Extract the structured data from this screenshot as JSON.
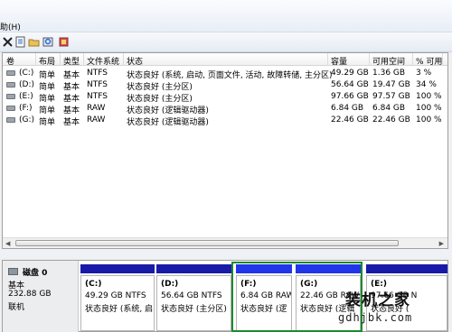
{
  "menubar": {
    "help_menu": "助(H)"
  },
  "toolbar": {
    "icons": [
      "close-icon",
      "properties-icon",
      "open-icon",
      "zoom-icon",
      "settings-icon"
    ]
  },
  "volumes": {
    "headers": [
      "卷",
      "布局",
      "类型",
      "文件系统",
      "状态",
      "容量",
      "可用空间",
      "% 可用"
    ],
    "rows": [
      {
        "vol": "(C:)",
        "layout": "简单",
        "type": "基本",
        "fs": "NTFS",
        "status": "状态良好 (系统, 启动, 页面文件, 活动, 故障转储, 主分区)",
        "capacity": "49.29 GB",
        "free": "1.36 GB",
        "pct": "3 %"
      },
      {
        "vol": "(D:)",
        "layout": "简单",
        "type": "基本",
        "fs": "NTFS",
        "status": "状态良好 (主分区)",
        "capacity": "56.64 GB",
        "free": "19.47 GB",
        "pct": "34 %"
      },
      {
        "vol": "(E:)",
        "layout": "简单",
        "type": "基本",
        "fs": "NTFS",
        "status": "状态良好 (主分区)",
        "capacity": "97.66 GB",
        "free": "97.57 GB",
        "pct": "100 %"
      },
      {
        "vol": "(F:)",
        "layout": "简单",
        "type": "基本",
        "fs": "RAW",
        "status": "状态良好 (逻辑驱动器)",
        "capacity": "6.84 GB",
        "free": "6.84 GB",
        "pct": "100 %"
      },
      {
        "vol": "(G:)",
        "layout": "简单",
        "type": "基本",
        "fs": "RAW",
        "status": "状态良好 (逻辑驱动器)",
        "capacity": "22.46 GB",
        "free": "22.46 GB",
        "pct": "100 %"
      }
    ]
  },
  "disk": {
    "name": "磁盘 0",
    "type": "基本",
    "size": "232.88 GB",
    "state": "联机",
    "partitions": [
      {
        "letter": "(C:)",
        "size": "49.29 GB NTFS",
        "status": "状态良好 (系统, 启",
        "kind": "primary"
      },
      {
        "letter": "(D:)",
        "size": "56.64 GB NTFS",
        "status": "状态良好 (主分区)",
        "kind": "primary"
      },
      {
        "letter": "(F:)",
        "size": "6.84 GB RAW",
        "status": "状态良好 (逻",
        "kind": "logical"
      },
      {
        "letter": "(G:)",
        "size": "22.46 GB RAW",
        "status": "状态良好 (逻辑",
        "kind": "logical"
      },
      {
        "letter": "(E:)",
        "size": "97.66 GB N",
        "status": "状态良好 (",
        "kind": "primary"
      }
    ]
  },
  "watermark": {
    "title": "装机之家",
    "url": "gdhjbk.com"
  },
  "colors": {
    "primary_bar": "#1a1aa8",
    "logical_bar": "#2036e8",
    "extended_frame": "#1e8a2e"
  }
}
